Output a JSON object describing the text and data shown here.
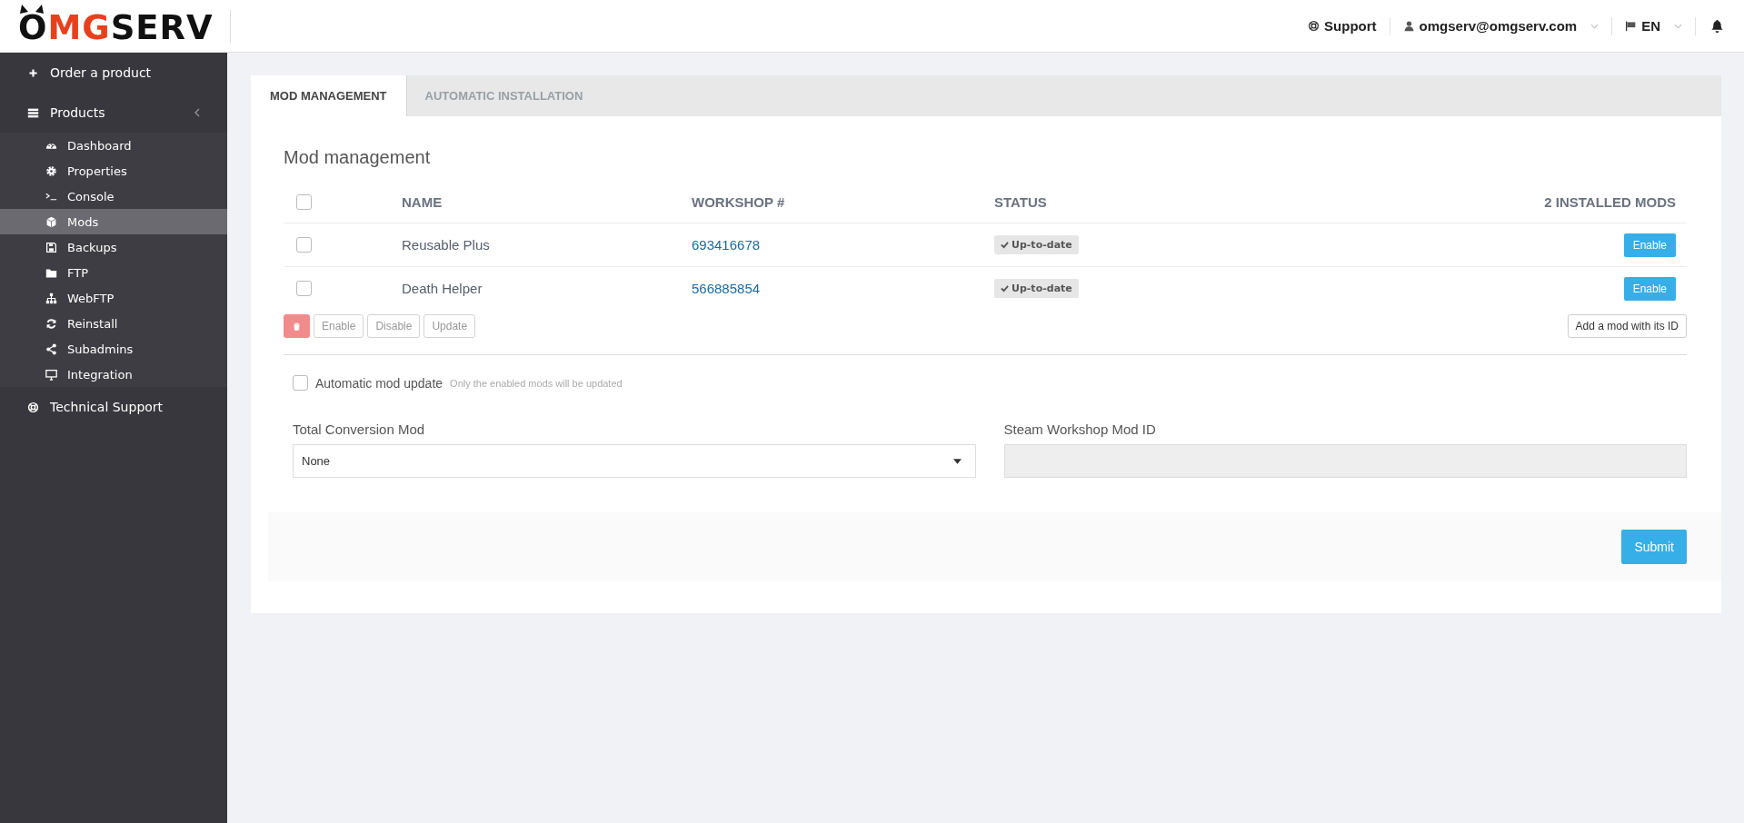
{
  "brand": {
    "start": "O",
    "accent": "MG",
    "end": "SERV"
  },
  "header": {
    "support": "Support",
    "user": "omgserv@omgserv.com",
    "language": "EN"
  },
  "sidebar": {
    "items": [
      {
        "label": "Order a product"
      },
      {
        "label": "Products",
        "expanded": true,
        "children": [
          {
            "label": "Dashboard",
            "selected": false
          },
          {
            "label": "Properties",
            "selected": false
          },
          {
            "label": "Console",
            "selected": false
          },
          {
            "label": "Mods",
            "selected": true
          },
          {
            "label": "Backups",
            "selected": false
          },
          {
            "label": "FTP",
            "selected": false
          },
          {
            "label": "WebFTP",
            "selected": false
          },
          {
            "label": "Reinstall",
            "selected": false
          },
          {
            "label": "Subadmins",
            "selected": false
          },
          {
            "label": "Integration",
            "selected": false
          }
        ]
      },
      {
        "label": "Technical Support"
      }
    ]
  },
  "tabs": [
    {
      "label": "MOD MANAGEMENT",
      "selected": true
    },
    {
      "label": "AUTOMATIC INSTALLATION",
      "selected": false
    }
  ],
  "section_title": "Mod management",
  "table": {
    "select_all_checked": false,
    "columns": [
      "NAME",
      "WORKSHOP #",
      "STATUS",
      "2 INSTALLED MODS"
    ],
    "rows": [
      {
        "checked": false,
        "name": "Reusable Plus",
        "workshop": "693416678",
        "status": "Up-to-date",
        "action": "Enable"
      },
      {
        "checked": false,
        "name": "Death Helper",
        "workshop": "566885854",
        "status": "Up-to-date",
        "action": "Enable"
      }
    ]
  },
  "bulk_actions": [
    {
      "label": "Enable",
      "disabled": true
    },
    {
      "label": "Disable",
      "disabled": true
    },
    {
      "label": "Update",
      "disabled": true
    }
  ],
  "add_mod_button": "Add a mod with its ID",
  "auto_update": {
    "label": "Automatic mod update",
    "hint": "Only the enabled mods will be updated",
    "checked": false
  },
  "total_conversion": {
    "label": "Total Conversion Mod",
    "value": "None"
  },
  "steam_id": {
    "label": "Steam Workshop Mod ID",
    "disabled": true
  },
  "submit": "Submit"
}
